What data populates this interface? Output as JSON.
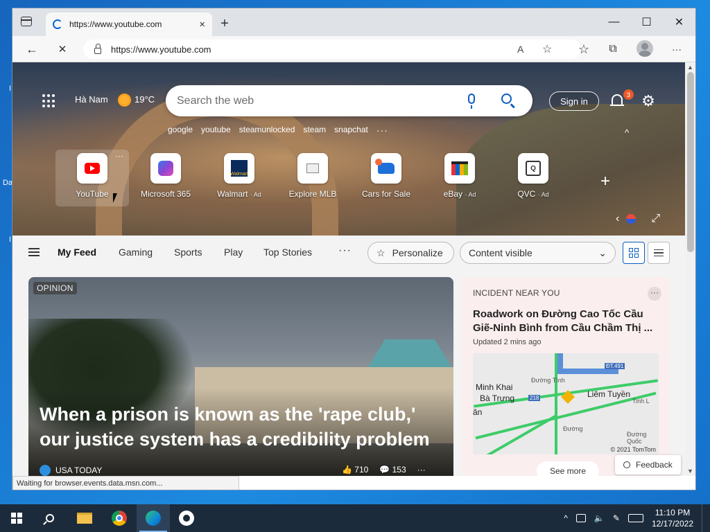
{
  "desktop": {
    "fragments": [
      "I",
      "Da",
      "I"
    ]
  },
  "browser": {
    "tab": {
      "title": "https://www.youtube.com",
      "close": "×"
    },
    "new_tab": "+",
    "window_controls": {
      "minimize": "—",
      "maximize": "☐",
      "close": "✕"
    },
    "toolbar": {
      "back": "←",
      "stop": "✕",
      "url": "https://www.youtube.com",
      "read_aloud": "A",
      "add_favorite": "☆",
      "favorites": "☆",
      "collections": "⧉",
      "more": "···"
    }
  },
  "hero": {
    "location": "Hà Nam",
    "temperature": "19°C",
    "search_placeholder": "Search the web",
    "sign_in": "Sign in",
    "notifications_count": "3",
    "settings": "⚙",
    "quicklinks": [
      "google",
      "youtube",
      "steamunlocked",
      "steam",
      "snapchat"
    ],
    "quicklinks_more": "···",
    "collapse": "^",
    "tiles": [
      {
        "label": "YouTube",
        "ad": ""
      },
      {
        "label": "Microsoft 365",
        "ad": ""
      },
      {
        "label": "Walmart",
        "ad": "· Ad"
      },
      {
        "label": "Explore MLB",
        "ad": ""
      },
      {
        "label": "Cars for Sale",
        "ad": ""
      },
      {
        "label": "eBay",
        "ad": "· Ad"
      },
      {
        "label": "QVC",
        "ad": "· Ad"
      }
    ],
    "walmart_icon_text": "Walmart",
    "qvc_icon_text": "Q",
    "tile_more": "···",
    "add_tile": "+",
    "prev": "‹",
    "expand": "⤢"
  },
  "feed": {
    "menu": "≡",
    "tabs": [
      "My Feed",
      "Gaming",
      "Sports",
      "Play",
      "Top Stories"
    ],
    "more": "···",
    "personalize": "Personalize",
    "content_visibility": "Content visible",
    "dropdown_chevron": "⌄"
  },
  "story": {
    "badge": "OPINION",
    "title": "When a prison is known as the 'rape club,' our justice system has a credibility problem",
    "source": "USA TODAY",
    "likes": "710",
    "comments": "153",
    "more": "···"
  },
  "incident": {
    "label": "INCIDENT NEAR YOU",
    "title": "Roadwork on Đường Cao Tốc Cầu Giẽ-Ninh Bình from Cầu Chầm Thị ...",
    "updated": "Updated 2 mins ago",
    "map_labels": {
      "minh_khai": "Minh Khai",
      "ba_trung": "Bà Trưng",
      "lien_tuyen": "Liêm Tuyền",
      "dt491": "ĐT.491",
      "r218": "218",
      "duong": "Đường",
      "tinh": "Tinh L",
      "an": "ăn",
      "duong_tinh": "Đường Tình",
      "duong_quoc": "Đường Quốc"
    },
    "map_credit": "© 2021 TomTom",
    "see_more": "See more",
    "more": "···"
  },
  "feedback": "Feedback",
  "status": "Waiting for browser.events.data.msn.com...",
  "scrollbar": {
    "up": "▲",
    "down": "▼"
  },
  "taskbar": {
    "time": "11:10 PM",
    "date": "12/17/2022",
    "tray_chevron": "^"
  }
}
